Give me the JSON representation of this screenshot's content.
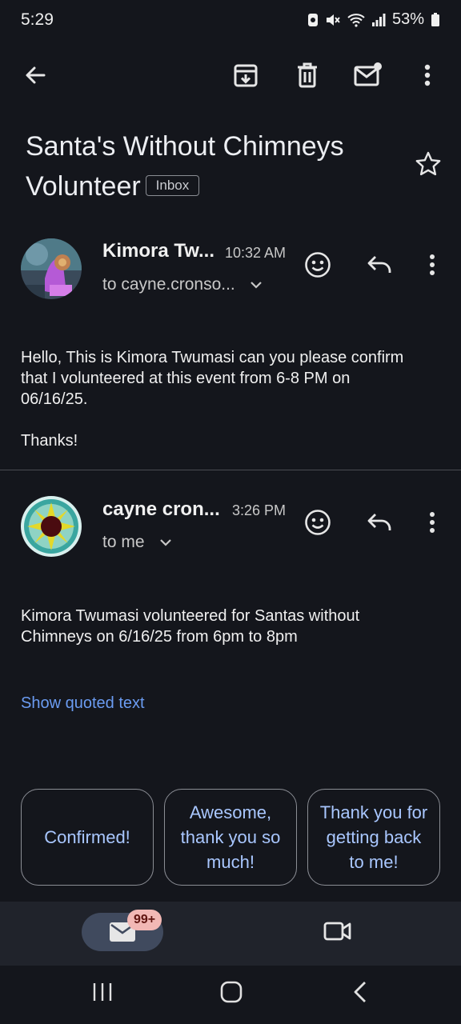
{
  "status_bar": {
    "time": "5:29",
    "battery": "53%",
    "icons": [
      "signal-app-icon",
      "mute-icon",
      "wifi-icon",
      "cell-signal-icon",
      "battery-icon"
    ]
  },
  "toolbar": {
    "icons": [
      "back-arrow-icon",
      "archive-icon",
      "delete-icon",
      "mark-unread-icon",
      "more-vert-icon"
    ]
  },
  "subject": {
    "line1": "Santa's Without Chimneys",
    "line2": "Volunteer",
    "label": "Inbox"
  },
  "messages": [
    {
      "sender": "Kimora Tw...",
      "time": "10:32 AM",
      "to": "to cayne.cronso...",
      "body_lines": [
        "Hello, This is Kimora Twumasi can you please confirm",
        "that I volunteered at this event from 6-8 PM on",
        "06/16/25.",
        "",
        "Thanks!"
      ]
    },
    {
      "sender": "cayne cron...",
      "time": "3:26 PM",
      "to": "to me",
      "body_lines": [
        "Kimora Twumasi volunteered for Santas without",
        "Chimneys on 6/16/25 from 6pm to 8pm"
      ]
    }
  ],
  "show_quoted": "Show quoted text",
  "smart_replies": [
    "Confirmed!",
    "Awesome, thank you so much!",
    "Thank you for getting back to me!"
  ],
  "bottom_nav": {
    "mail_badge": "99+"
  },
  "colors": {
    "background": "#14161c",
    "link": "#6b9cf2",
    "chip_text": "#a9c7ff",
    "badge_bg": "#f2b8b5"
  }
}
